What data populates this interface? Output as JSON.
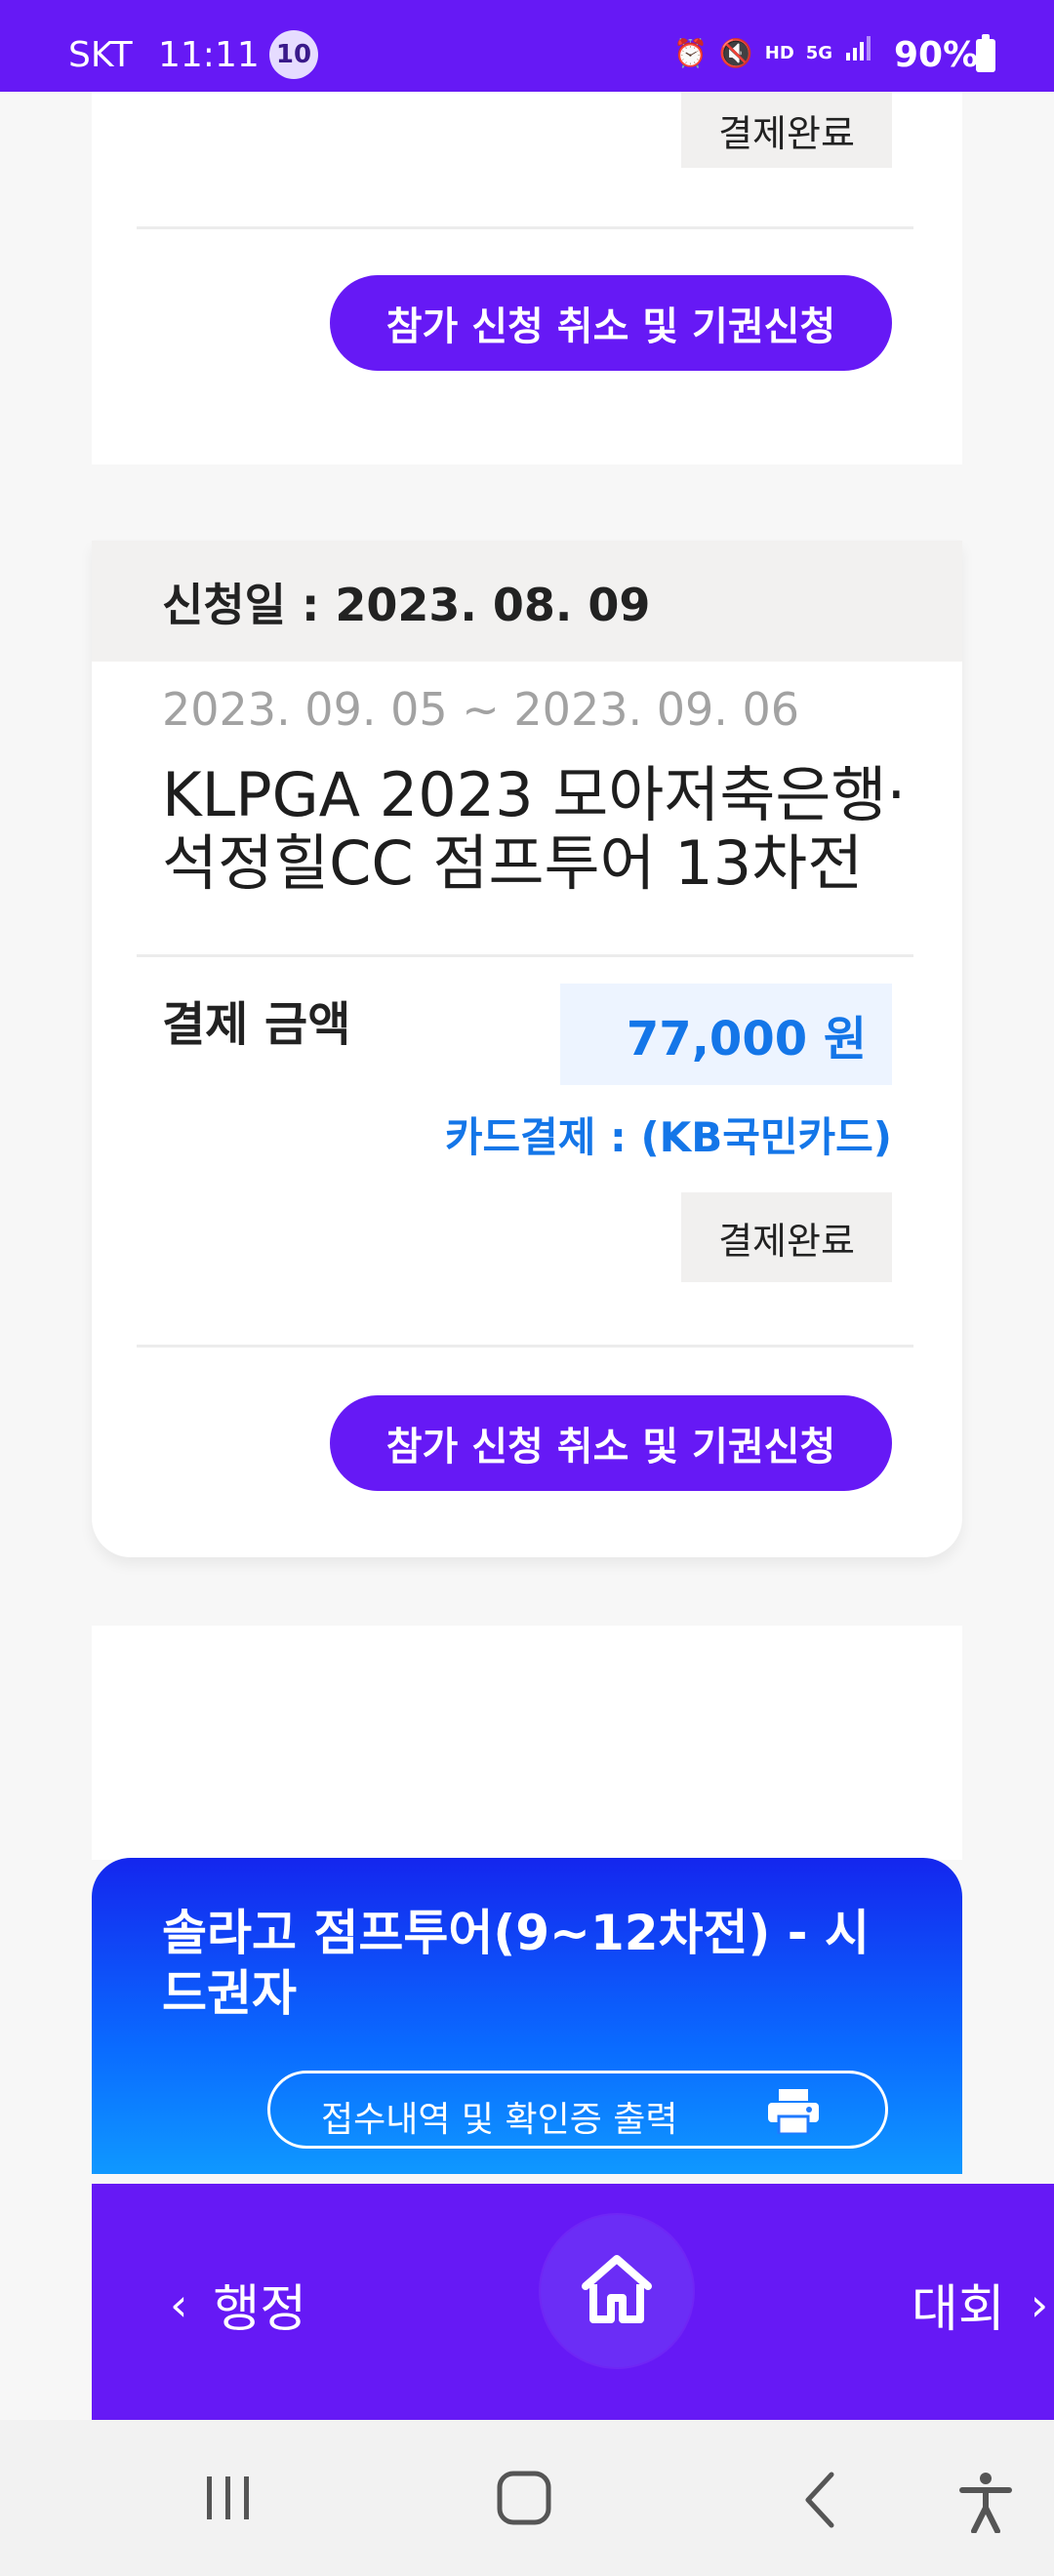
{
  "status_bar": {
    "carrier": "SKT",
    "time": "11:11",
    "notification_count": "10",
    "icons": [
      "alarm-icon",
      "mute-icon",
      "hd-voice-icon",
      "5g-icon",
      "signal-icon",
      "battery-icon"
    ],
    "battery": "90%"
  },
  "card1": {
    "status": "결제완료",
    "cancel_label": "참가 신청 취소 및 기권신청"
  },
  "card2": {
    "apply_date": "신청일 : 2023. 08. 09",
    "period": "2023. 09. 05 ~ 2023. 09. 06",
    "tournament_name": "KLPGA 2023 모아저축은행·석정힐CC 점프투어 13차전",
    "amount_label": "결제 금액",
    "amount_value": "77,000 원",
    "payment_method": "카드결제 : (KB국민카드)",
    "status": "결제완료",
    "cancel_label": "참가 신청 취소 및 기권신청"
  },
  "blue_card": {
    "title": "솔라고 점프투어(9~12차전) - 시드권자",
    "print_label": "접수내역 및 확인증 출력",
    "print_icon": "printer-icon"
  },
  "bottom_nav": {
    "left_label": "행정",
    "right_label": "대회",
    "home_icon": "home-icon"
  },
  "system_nav": [
    "recent-apps-icon",
    "home-circle-icon",
    "back-icon",
    "accessibility-icon"
  ],
  "colors": {
    "primary_purple": "#6619f5",
    "accent_blue": "#1476e8",
    "gradient_top": "#1426ee",
    "gradient_bottom": "#0f98ff"
  }
}
